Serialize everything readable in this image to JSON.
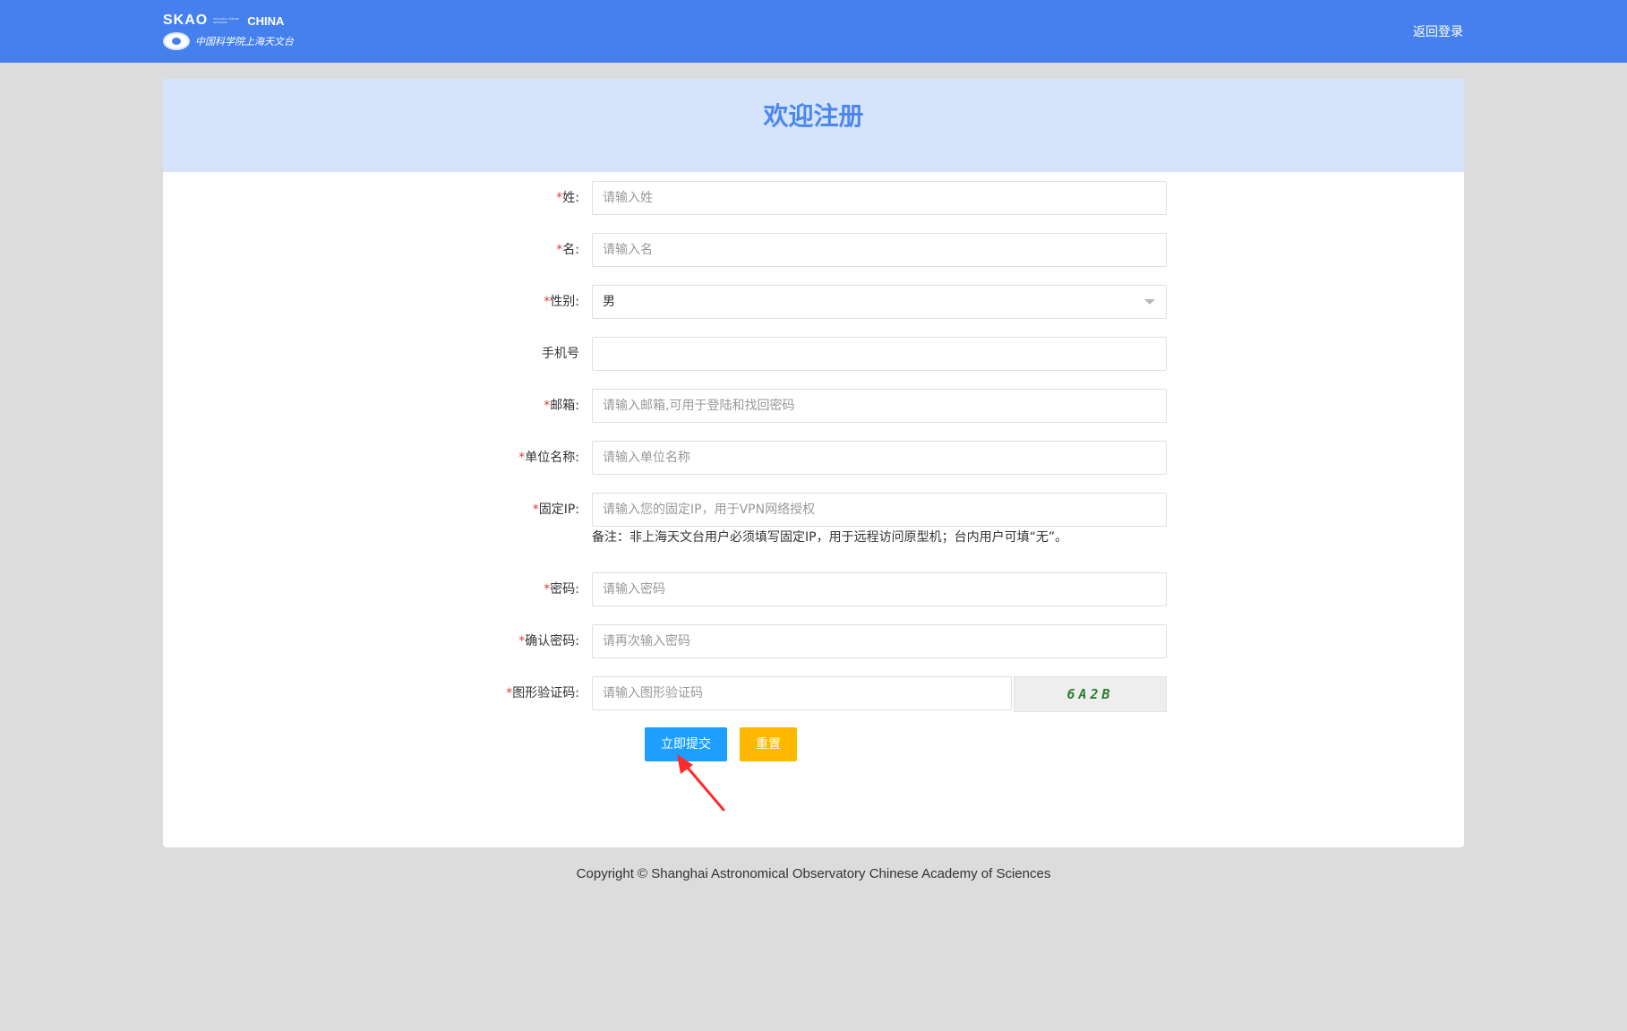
{
  "header": {
    "logo_brand": "SKAO",
    "logo_small_text": "REGIONAL CENTRE NETWORK",
    "logo_country": "CHINA",
    "logo_org_cn": "中国科学院上海天文台",
    "back_login": "返回登录",
    "bg_color": "#4680ee"
  },
  "page": {
    "title": "欢迎注册"
  },
  "form": {
    "required_mark": "*",
    "fields": [
      {
        "label": "姓:",
        "placeholder": "请输入姓",
        "required": true
      },
      {
        "label": "名:",
        "placeholder": "请输入名",
        "required": true
      },
      {
        "label": "性别:",
        "value": "男",
        "required": true,
        "type": "select"
      },
      {
        "label": "手机号",
        "placeholder": "",
        "required": false
      },
      {
        "label": "邮箱:",
        "placeholder": "请输入邮箱,可用于登陆和找回密码",
        "required": true
      },
      {
        "label": "单位名称:",
        "placeholder": "请输入单位名称",
        "required": true
      },
      {
        "label": "固定IP:",
        "placeholder": "请输入您的固定IP，用于VPN网络授权",
        "required": true
      },
      {
        "label": "密码:",
        "placeholder": "请输入密码",
        "required": true
      },
      {
        "label": "确认密码:",
        "placeholder": "请再次输入密码",
        "required": true
      },
      {
        "label": "图形验证码:",
        "placeholder": "请输入图形验证码",
        "required": true
      }
    ],
    "ip_note": "备注：非上海天文台用户必须填写固定IP，用于远程访问原型机；台内用户可填“无”。",
    "captcha_text": "6A2B",
    "submit_label": "立即提交",
    "reset_label": "重置",
    "submit_color": "#1e9fff",
    "reset_color": "#ffb800"
  },
  "footer": {
    "copyright": "Copyright © Shanghai Astronomical Observatory Chinese Academy of Sciences"
  }
}
